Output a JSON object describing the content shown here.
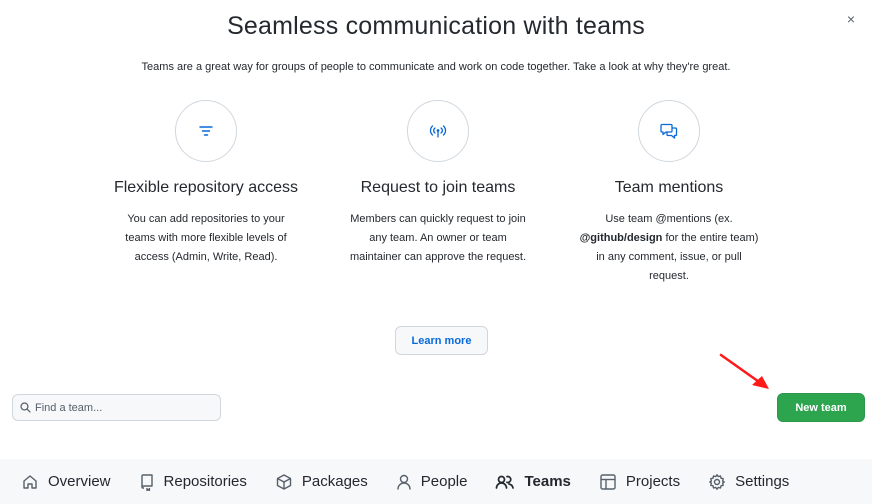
{
  "dialog": {
    "close_glyph": "×",
    "title": "Seamless communication with teams",
    "subtitle": "Teams are a great way for groups of people to communicate and work on code together. Take a look at why they're great."
  },
  "features": [
    {
      "icon": "filter-icon",
      "title": "Flexible repository access",
      "description": "You can add repositories to your teams with more flexible levels of access (Admin, Write, Read)."
    },
    {
      "icon": "broadcast-icon",
      "title": "Request to join teams",
      "description": "Members can quickly request to join any team. An owner or team maintainer can approve the request."
    },
    {
      "icon": "comment-discussion-icon",
      "title": "Team mentions",
      "description_before": "Use team @mentions (ex.",
      "description_bold": "@github/design",
      "description_after": "for the entire team) in any comment, issue, or pull request."
    }
  ],
  "learn_more_label": "Learn more",
  "search": {
    "placeholder": "Find a team..."
  },
  "new_team_label": "New team",
  "nav": {
    "items": [
      {
        "label": "Overview",
        "icon": "home-icon"
      },
      {
        "label": "Repositories",
        "icon": "repo-icon"
      },
      {
        "label": "Packages",
        "icon": "package-icon"
      },
      {
        "label": "People",
        "icon": "person-icon"
      },
      {
        "label": "Teams",
        "icon": "people-icon",
        "active": true
      },
      {
        "label": "Projects",
        "icon": "table-icon"
      },
      {
        "label": "Settings",
        "icon": "gear-icon"
      }
    ]
  },
  "colors": {
    "primary_button": "#2da44e",
    "link": "#0969da",
    "annotation_arrow": "#ff0000",
    "nav_background": "#f6f8fa"
  }
}
